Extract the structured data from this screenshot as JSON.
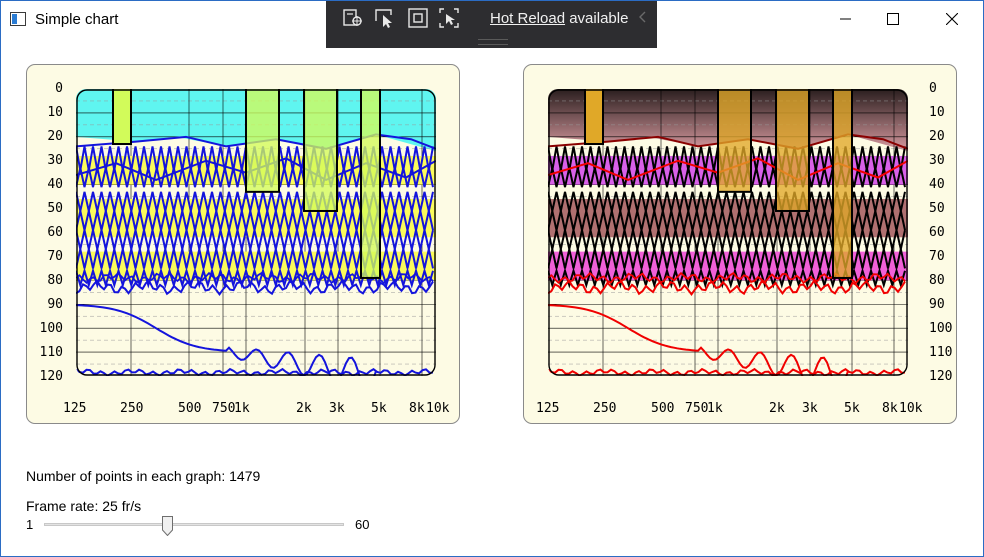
{
  "window": {
    "title": "Simple chart",
    "icon": "window-app-icon",
    "controls": [
      "minimize-icon",
      "maximize-icon",
      "close-icon"
    ]
  },
  "debug_toolbar": {
    "icons": [
      "live-visual-tree-icon",
      "select-element-icon",
      "display-layout-adorners-icon",
      "track-focus-icon"
    ],
    "hot_reload_link": "Hot Reload",
    "hot_reload_suffix": " available",
    "collapse_icon": "chevron-left-icon"
  },
  "charts": {
    "y_ticks": [
      "0",
      "10",
      "20",
      "30",
      "40",
      "50",
      "60",
      "70",
      "80",
      "90",
      "100",
      "110",
      "120"
    ],
    "x_ticks": [
      "125",
      "250",
      "500",
      "750",
      "1k",
      "2k",
      "3k",
      "5k",
      "8k",
      "10k"
    ],
    "left_palette": {
      "background": "#5ff5f0",
      "band": "#fbfb5c",
      "line": "#1414dc",
      "bar": "#d2fb5a"
    },
    "right_palette": {
      "background": "#b07078",
      "bands": [
        "#d860e8",
        "#b07070",
        "#f060d8"
      ],
      "line": "#f00000",
      "dark_line": "#000000",
      "bar": "#e0a828"
    }
  },
  "info": {
    "points_text": "Number of points in each graph: 1479",
    "frame_rate_text": "Frame rate: 25 fr/s",
    "slider_min": "1",
    "slider_max": "60",
    "frame_rate_value": 25
  }
}
